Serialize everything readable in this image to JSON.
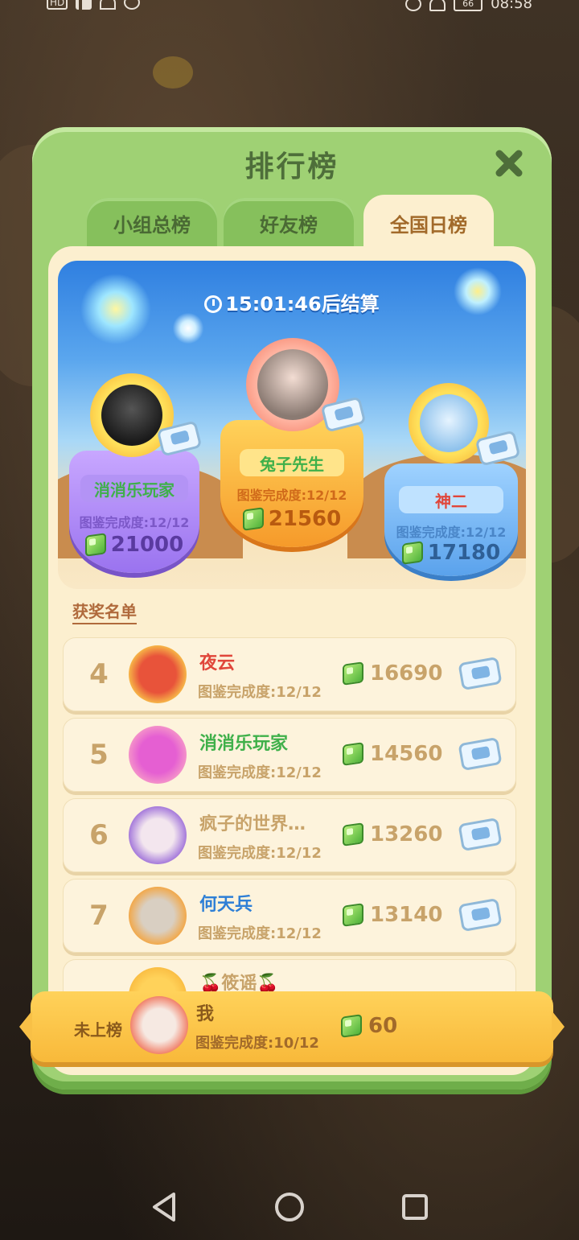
{
  "status_bar": {
    "left": "HD",
    "time": "08:58",
    "battery": "66"
  },
  "panel": {
    "title": "排行榜",
    "close_icon": "close-icon"
  },
  "tabs": [
    {
      "label": "小组总榜",
      "active": false
    },
    {
      "label": "好友榜",
      "active": false
    },
    {
      "label": "全国日榜",
      "active": true
    }
  ],
  "timer": {
    "text": "15:01:46后结算"
  },
  "podium": {
    "first": {
      "name": "兔子先生",
      "progress": "图鉴完成度:12/12",
      "score": "21560"
    },
    "second": {
      "name": "消消乐玩家",
      "progress": "图鉴完成度:12/12",
      "score": "21000"
    },
    "third": {
      "name": "神二",
      "progress": "图鉴完成度:12/12",
      "score": "17180"
    }
  },
  "winners_label": "获奖名单",
  "rows": [
    {
      "rank": "4",
      "name": "夜云",
      "name_color": "#e0463a",
      "progress": "图鉴完成度:12/12",
      "score": "16690"
    },
    {
      "rank": "5",
      "name": "消消乐玩家",
      "name_color": "#3fb04a",
      "progress": "图鉴完成度:12/12",
      "score": "14560"
    },
    {
      "rank": "6",
      "name": "疯子的世界…",
      "name_color": "#c8a36a",
      "progress": "图鉴完成度:12/12",
      "score": "13260"
    },
    {
      "rank": "7",
      "name": "何天兵",
      "name_color": "#2e7fd6",
      "progress": "图鉴完成度:12/12",
      "score": "13140"
    },
    {
      "rank": "",
      "name": "🍒筱谣🍒",
      "name_color": "#c8a36a",
      "progress": "",
      "score": ""
    }
  ],
  "me": {
    "status": "未上榜",
    "name": "我",
    "progress": "图鉴完成度:10/12",
    "score": "60"
  },
  "nav": {
    "back_icon": "back-triangle-icon",
    "home_icon": "home-circle-icon",
    "recent_icon": "recent-square-icon"
  }
}
